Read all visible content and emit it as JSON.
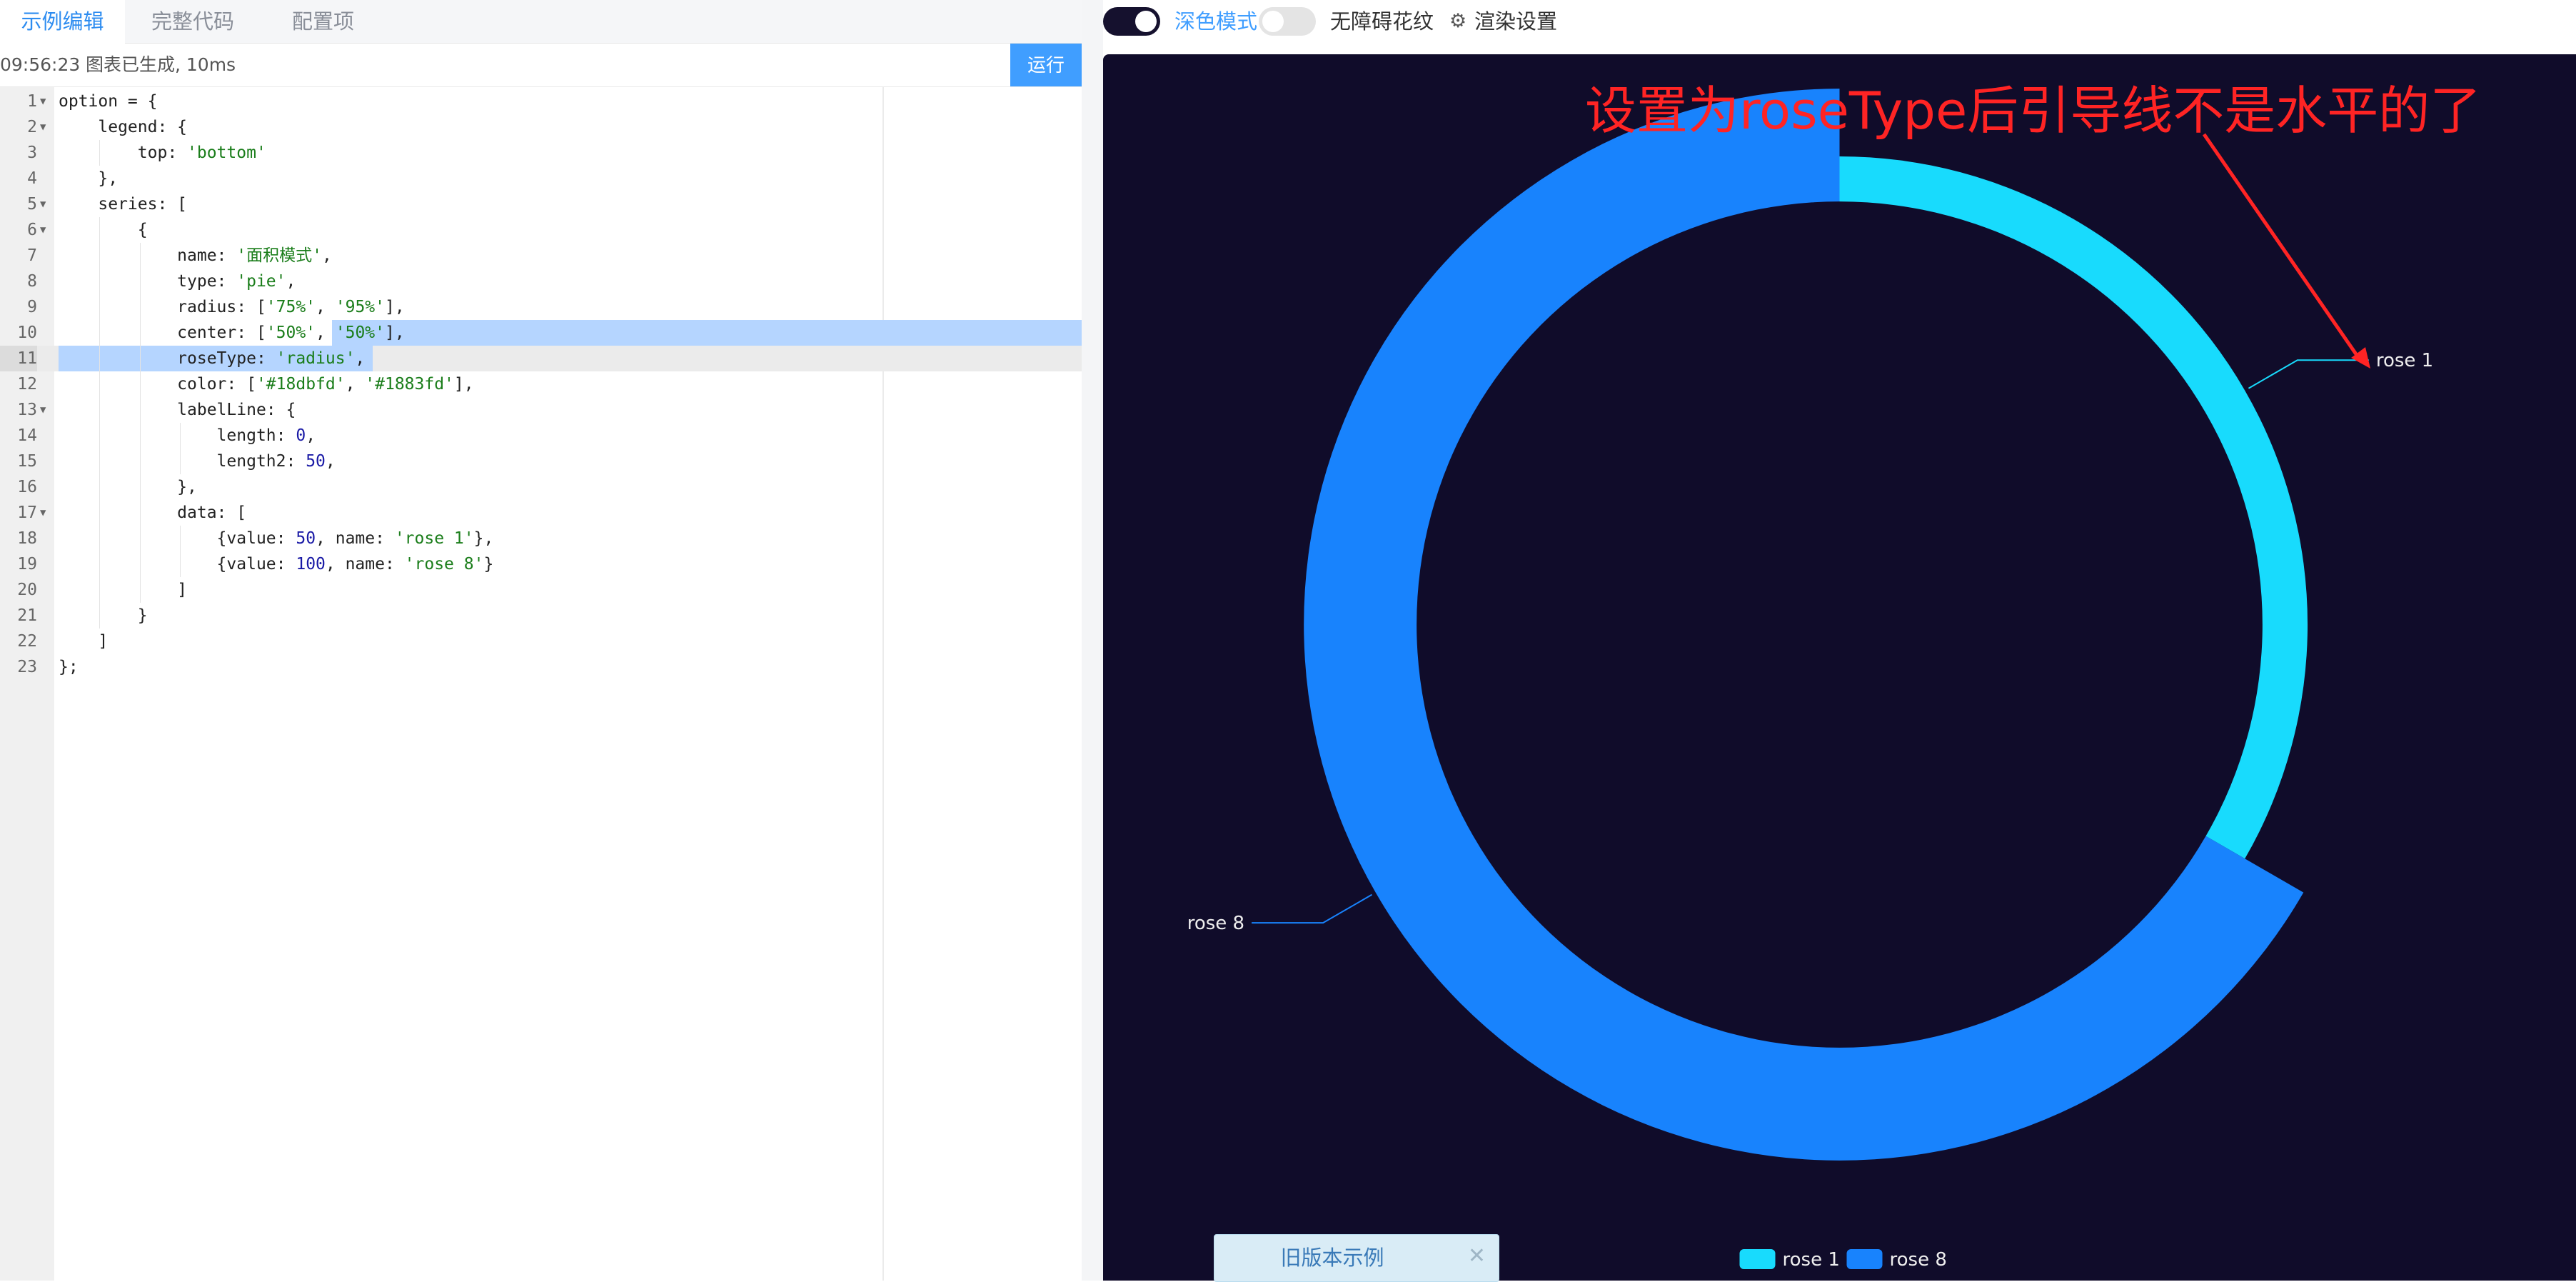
{
  "tabs": [
    {
      "label": "示例编辑",
      "active": true
    },
    {
      "label": "完整代码",
      "active": false
    },
    {
      "label": "配置项",
      "active": false
    }
  ],
  "status": {
    "time": "09:56:23",
    "message": "图表已生成, 10ms"
  },
  "run_button_label": "运行",
  "code_lines": [
    "option = {",
    "    legend: {",
    "        top: 'bottom'",
    "    },",
    "    series: [",
    "        {",
    "            name: '面积模式',",
    "            type: 'pie',",
    "            radius: ['75%', '95%'],",
    "            center: ['50%', '50%'],",
    "            roseType: 'radius',",
    "            color: ['#18dbfd', '#1883fd'],",
    "            labelLine: {",
    "                length: 0,",
    "                length2: 50,",
    "            },",
    "            data: [",
    "                {value: 50, name: 'rose 1'},",
    "                {value: 100, name: 'rose 8'}",
    "            ]",
    "        }",
    "    ]",
    "};"
  ],
  "line_numbers": [
    "1",
    "2",
    "3",
    "4",
    "5",
    "6",
    "7",
    "8",
    "9",
    "10",
    "11",
    "12",
    "13",
    "14",
    "15",
    "16",
    "17",
    "18",
    "19",
    "20",
    "21",
    "22",
    "23"
  ],
  "active_line": 11,
  "toolbar": {
    "dark_mode_label": "深色模式",
    "dark_mode_on": true,
    "aria_label": "无障碍花纹",
    "aria_on": false,
    "render_settings_label": "渲染设置"
  },
  "annotation_text": "设置为roseType后引导线不是水平的了",
  "chart_data": {
    "type": "pie",
    "rose_type": "radius",
    "radius": [
      "75%",
      "95%"
    ],
    "center": [
      "50%",
      "50%"
    ],
    "background": "#100c2a",
    "series": [
      {
        "name": "面积模式",
        "data": [
          {
            "name": "rose 1",
            "value": 50,
            "color": "#18dbfd"
          },
          {
            "name": "rose 8",
            "value": 100,
            "color": "#1883fd"
          }
        ]
      }
    ],
    "legend": {
      "placement": "bottom",
      "items": [
        "rose 1",
        "rose 8"
      ]
    },
    "labels": [
      "rose 1",
      "rose 8"
    ]
  },
  "old_version_label": "旧版本示例",
  "colors": {
    "accent": "#409eff",
    "chart_bg": "#100c2a",
    "annotation": "#ff2424"
  }
}
